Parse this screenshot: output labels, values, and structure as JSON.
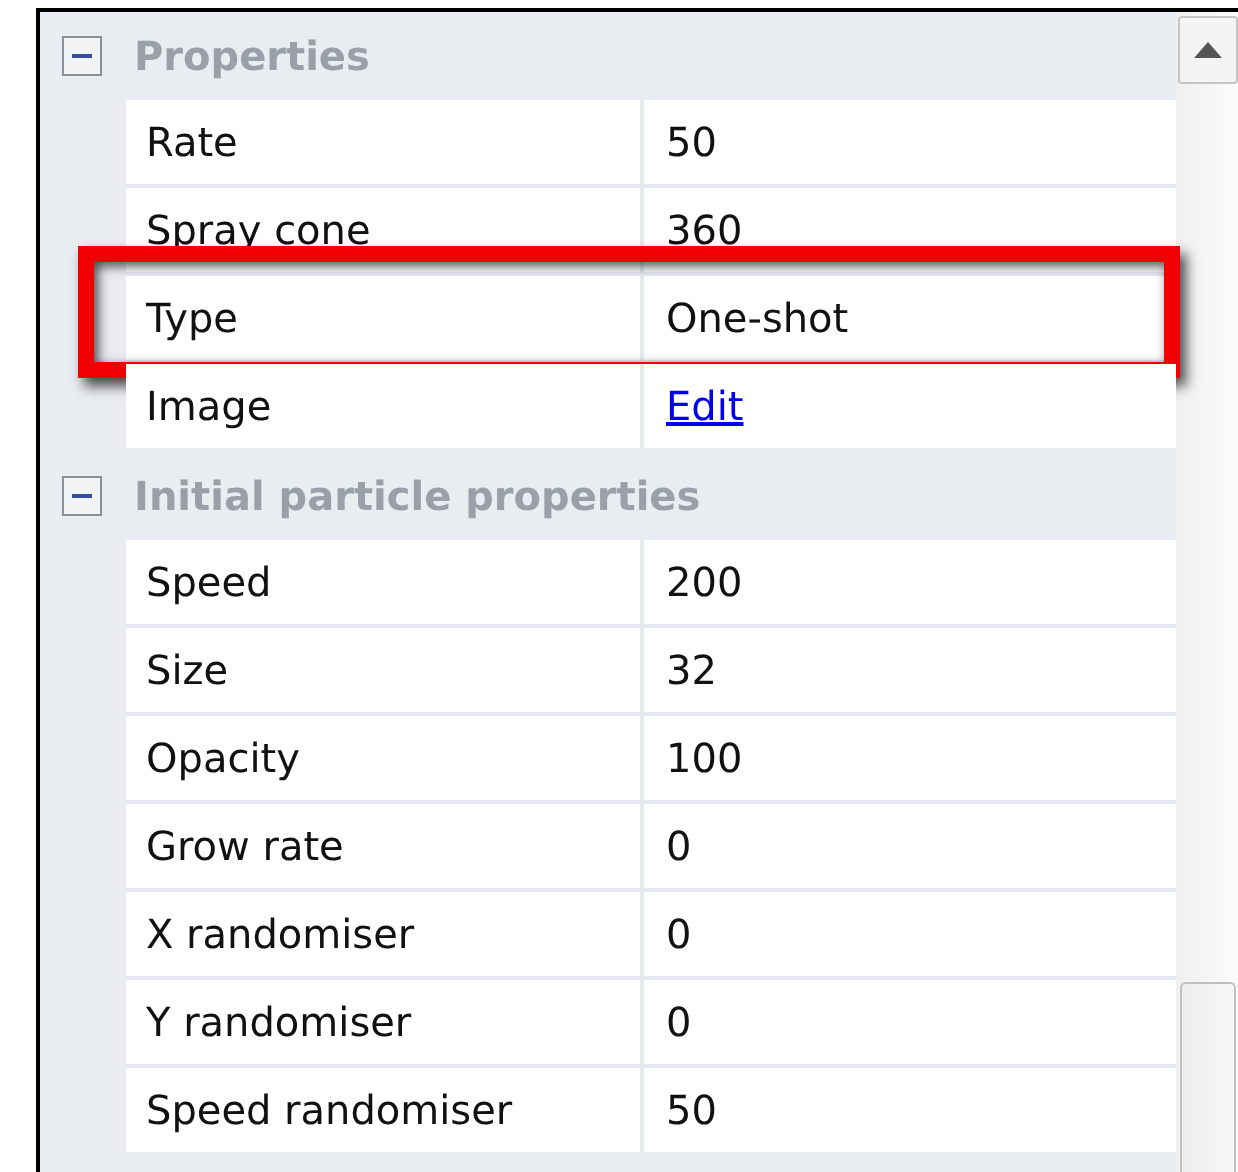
{
  "sections": [
    {
      "title": "Properties",
      "expanded": true,
      "rows": [
        {
          "name": "Rate",
          "value": "50",
          "kind": "text",
          "highlighted": false
        },
        {
          "name": "Spray cone",
          "value": "360",
          "kind": "text",
          "highlighted": false
        },
        {
          "name": "Type",
          "value": "One-shot",
          "kind": "text",
          "highlighted": true
        },
        {
          "name": "Image",
          "value": "Edit",
          "kind": "link",
          "highlighted": false
        }
      ]
    },
    {
      "title": "Initial particle properties",
      "expanded": true,
      "rows": [
        {
          "name": "Speed",
          "value": "200",
          "kind": "text",
          "highlighted": false
        },
        {
          "name": "Size",
          "value": "32",
          "kind": "text",
          "highlighted": false
        },
        {
          "name": "Opacity",
          "value": "100",
          "kind": "text",
          "highlighted": false
        },
        {
          "name": "Grow rate",
          "value": "0",
          "kind": "text",
          "highlighted": false
        },
        {
          "name": "X randomiser",
          "value": "0",
          "kind": "text",
          "highlighted": false
        },
        {
          "name": "Y randomiser",
          "value": "0",
          "kind": "text",
          "highlighted": false
        },
        {
          "name": "Speed randomiser",
          "value": "50",
          "kind": "text",
          "highlighted": false
        }
      ]
    }
  ]
}
